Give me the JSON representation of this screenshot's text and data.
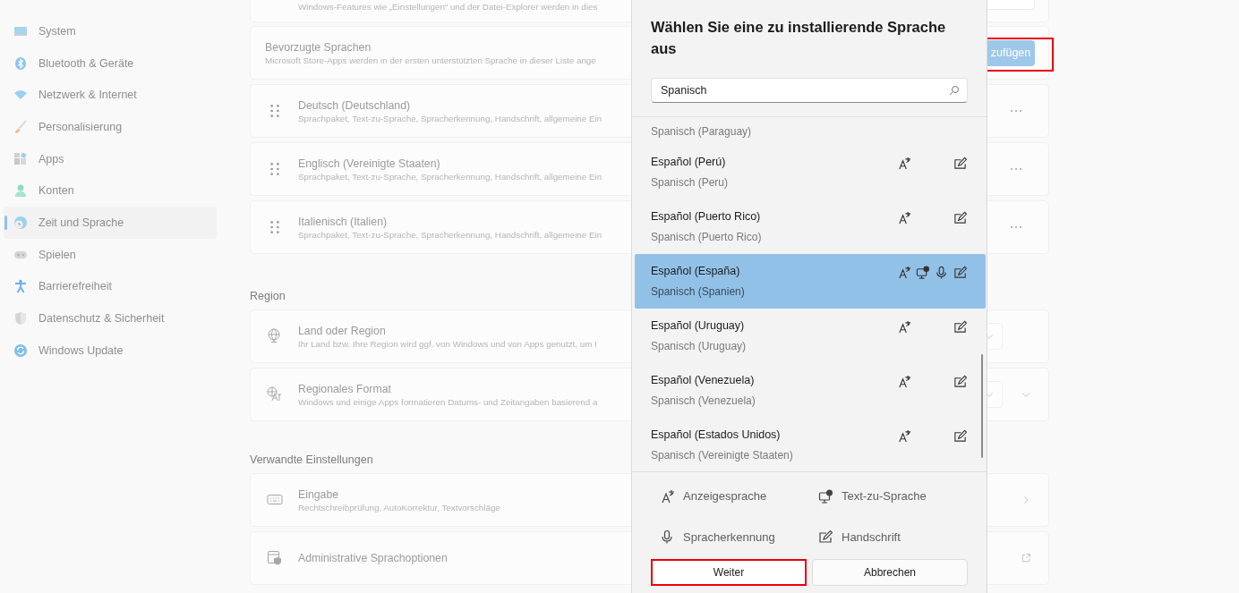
{
  "sidebar": {
    "items": [
      {
        "label": "System",
        "selected": false
      },
      {
        "label": "Bluetooth & Geräte",
        "selected": false
      },
      {
        "label": "Netzwerk & Internet",
        "selected": false
      },
      {
        "label": "Personalisierung",
        "selected": false
      },
      {
        "label": "Apps",
        "selected": false
      },
      {
        "label": "Konten",
        "selected": false
      },
      {
        "label": "Zeit und Sprache",
        "selected": true
      },
      {
        "label": "Spielen",
        "selected": false
      },
      {
        "label": "Barrierefreiheit",
        "selected": false
      },
      {
        "label": "Datenschutz & Sicherheit",
        "selected": false
      },
      {
        "label": "Windows Update",
        "selected": false
      }
    ]
  },
  "page": {
    "top_card": {
      "description": "Windows-Features wie „Einstellungen“ und der Datei-Explorer werden in dies"
    },
    "preferred_languages": {
      "title": "Bevorzugte Sprachen",
      "description": "Microsoft Store-Apps werden in der ersten unterstützten Sprache in dieser Liste ange",
      "add_button": {
        "label": "zufügen",
        "highlighted": true
      }
    },
    "languages": [
      {
        "name": "Deutsch (Deutschland)",
        "description": "Sprachpaket, Text-zu-Sprache, Spracherkennung, Handschrift, allgemeine Ein"
      },
      {
        "name": "Englisch (Vereinigte Staaten)",
        "description": "Sprachpaket, Text-zu-Sprache, Spracherkennung, Handschrift, allgemeine Ein"
      },
      {
        "name": "Italienisch (Italien)",
        "description": "Sprachpaket, Text-zu-Sprache, Spracherkennung, Handschrift, allgemeine Ein"
      }
    ],
    "region": {
      "heading": "Region",
      "items": [
        {
          "kind": "globe",
          "title": "Land oder Region",
          "description": "Ihr Land bzw. Ihre Region wird ggf. von Windows und von Apps genutzt, um I",
          "control": {
            "kind": "dropdown"
          }
        },
        {
          "kind": "translate",
          "title": "Regionales Format",
          "description": "Windows und einige Apps formatieren Datums- und Zeitangaben basierend a",
          "control": {
            "kind": "dropdown_expand"
          }
        }
      ]
    },
    "related": {
      "heading": "Verwandte Einstellungen",
      "items": [
        {
          "kind": "keyboard",
          "title": "Eingabe",
          "description": "Rechtschreibprüfung, AutoKorrektur, Textvorschläge",
          "control": {
            "kind": "chevron"
          }
        },
        {
          "kind": "shield_window",
          "title": "Administrative Sprachoptionen",
          "control": {
            "kind": "external"
          }
        }
      ]
    }
  },
  "dialog": {
    "title": "Wählen Sie eine zu installierende Sprache aus",
    "search": {
      "value": "Spanisch"
    },
    "partial_row": {
      "secondary": "Spanisch (Paraguay)"
    },
    "languages": [
      {
        "name": "Español (Perú)",
        "secondary": "Spanisch (Peru)",
        "selected": false,
        "features": {
          "display": true,
          "tts": false,
          "speech": false,
          "handwriting": true
        }
      },
      {
        "name": "Español (Puerto Rico)",
        "secondary": "Spanisch (Puerto Rico)",
        "selected": false,
        "features": {
          "display": true,
          "tts": false,
          "speech": false,
          "handwriting": true
        }
      },
      {
        "name": "Español (España)",
        "secondary": "Spanisch (Spanien)",
        "selected": true,
        "features": {
          "display": true,
          "tts": true,
          "speech": true,
          "handwriting": true
        }
      },
      {
        "name": "Español (Uruguay)",
        "secondary": "Spanisch (Uruguay)",
        "selected": false,
        "features": {
          "display": true,
          "tts": false,
          "speech": false,
          "handwriting": true
        }
      },
      {
        "name": "Español (Venezuela)",
        "secondary": "Spanisch (Venezuela)",
        "selected": false,
        "features": {
          "display": true,
          "tts": false,
          "speech": false,
          "handwriting": true
        }
      },
      {
        "name": "Español (Estados Unidos)",
        "secondary": "Spanisch (Vereinigte Staaten)",
        "selected": false,
        "features": {
          "display": true,
          "tts": false,
          "speech": false,
          "handwriting": true
        }
      }
    ],
    "legend": [
      {
        "kind": "display",
        "label": "Anzeigesprache"
      },
      {
        "kind": "tts",
        "label": "Text-zu-Sprache"
      },
      {
        "kind": "speech",
        "label": "Spracherkennung"
      },
      {
        "kind": "handwriting",
        "label": "Handschrift"
      }
    ],
    "buttons": [
      {
        "label": "Weiter",
        "highlighted": true
      },
      {
        "label": "Abbrechen",
        "highlighted": false
      }
    ]
  }
}
